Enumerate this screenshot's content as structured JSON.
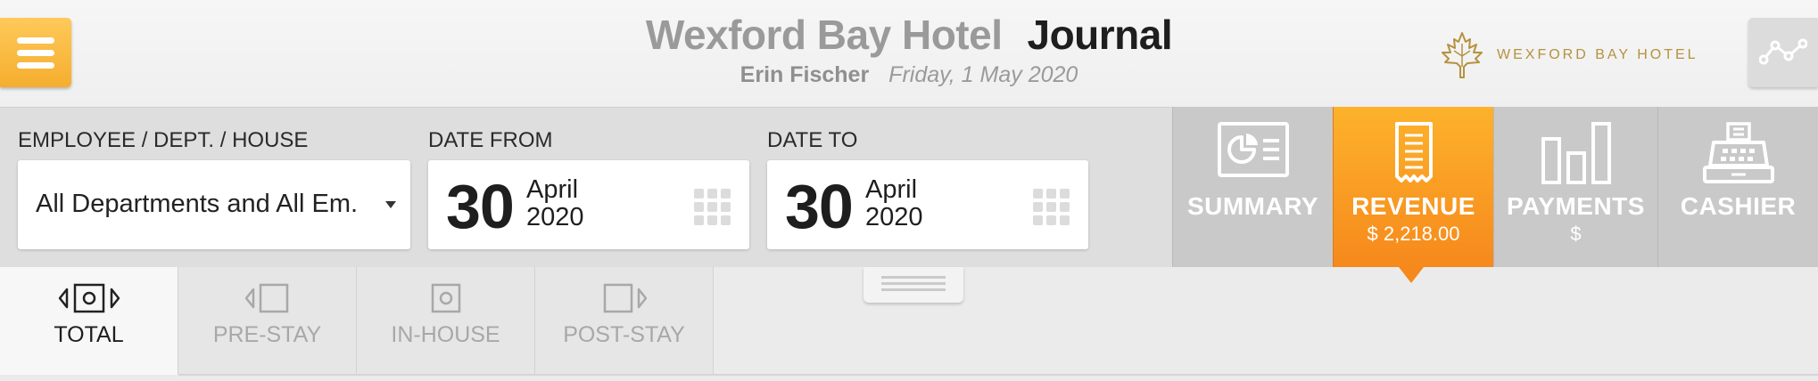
{
  "header": {
    "hotel_name": "Wexford Bay Hotel",
    "page_title": "Journal",
    "user_name": "Erin Fischer",
    "current_date": "Friday, 1 May 2020",
    "logo_text": "WEXFORD BAY HOTEL"
  },
  "filters": {
    "employee_label": "EMPLOYEE / DEPT. / HOUSE",
    "employee_value": "All Departments and All Em.",
    "date_from_label": "DATE FROM",
    "date_from": {
      "day": "30",
      "month": "April",
      "year": "2020"
    },
    "date_to_label": "DATE TO",
    "date_to": {
      "day": "30",
      "month": "April",
      "year": "2020"
    }
  },
  "report_tabs": [
    {
      "label": "SUMMARY",
      "value": "",
      "active": false,
      "icon": "summary-card-icon"
    },
    {
      "label": "REVENUE",
      "value": "$ 2,218.00",
      "active": true,
      "icon": "receipt-icon"
    },
    {
      "label": "PAYMENTS",
      "value": "$",
      "active": false,
      "icon": "bar-chart-icon"
    },
    {
      "label": "CASHIER",
      "value": "",
      "active": false,
      "icon": "cash-register-icon"
    }
  ],
  "stage_tabs": [
    {
      "label": "TOTAL",
      "active": true,
      "icon": "total-stay-icon"
    },
    {
      "label": "PRE-STAY",
      "active": false,
      "icon": "pre-stay-icon"
    },
    {
      "label": "IN-HOUSE",
      "active": false,
      "icon": "in-house-icon"
    },
    {
      "label": "POST-STAY",
      "active": false,
      "icon": "post-stay-icon"
    }
  ],
  "colors": {
    "accent_orange": "#f6891c",
    "menu_yellow": "#f5ae2e",
    "logo_gold": "#b5923e"
  }
}
